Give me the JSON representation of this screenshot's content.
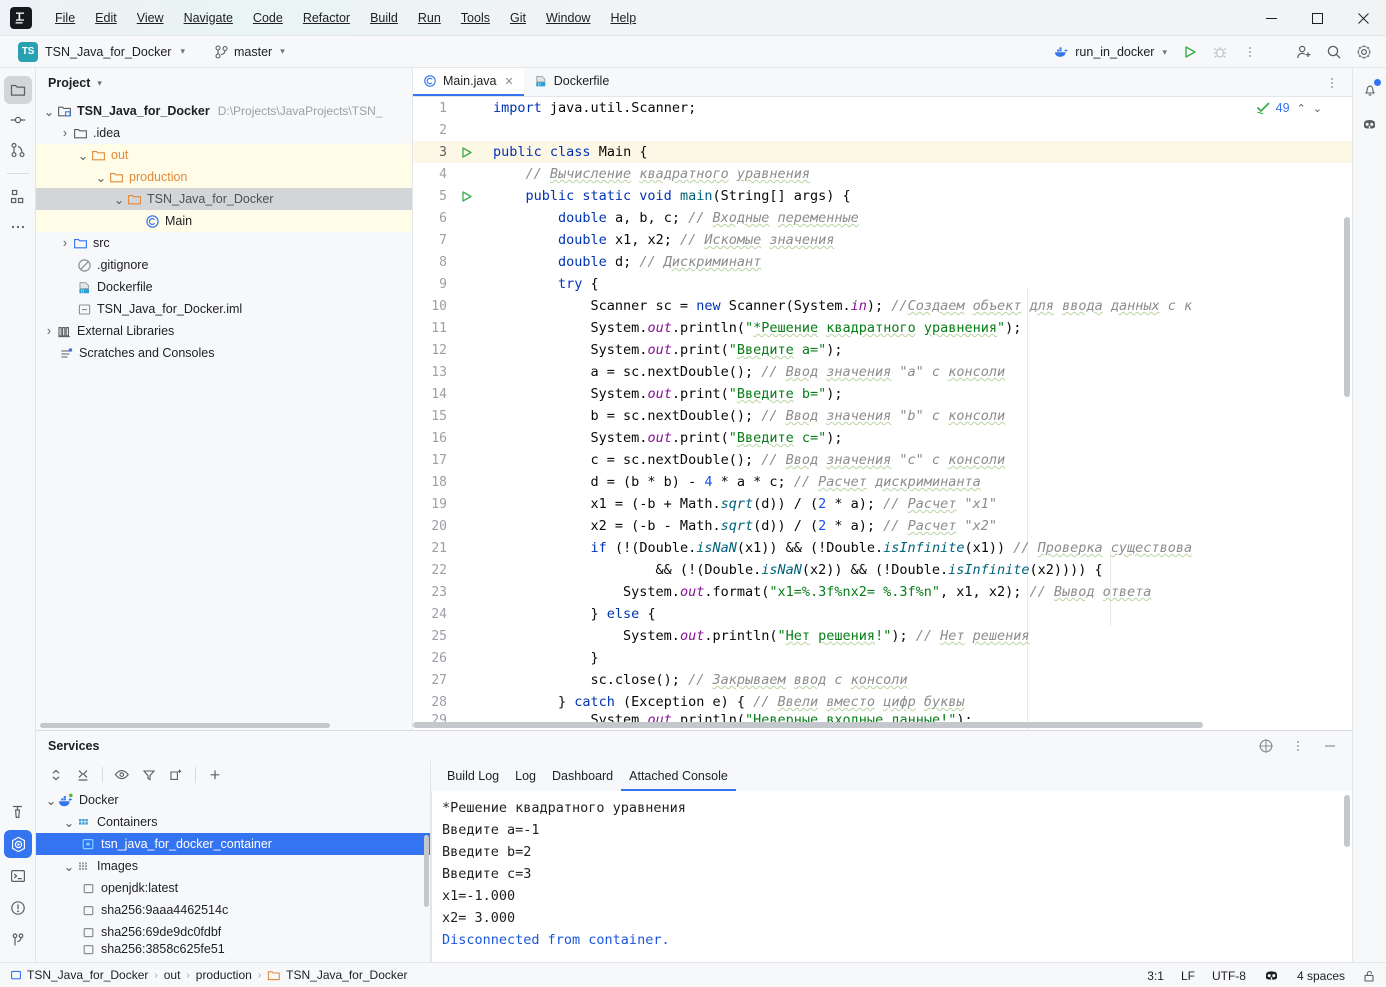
{
  "window": {
    "minimize_label": "Minimize",
    "maximize_label": "Maximize",
    "close_label": "Close"
  },
  "menubar": {
    "items": [
      {
        "label": "File",
        "mnemonic": "F"
      },
      {
        "label": "Edit",
        "mnemonic": "E"
      },
      {
        "label": "View",
        "mnemonic": "V"
      },
      {
        "label": "Navigate",
        "mnemonic": "N"
      },
      {
        "label": "Code",
        "mnemonic": "C"
      },
      {
        "label": "Refactor",
        "mnemonic": "R"
      },
      {
        "label": "Build",
        "mnemonic": "B"
      },
      {
        "label": "Run",
        "mnemonic": "u"
      },
      {
        "label": "Tools",
        "mnemonic": "T"
      },
      {
        "label": "Git",
        "mnemonic": "G"
      },
      {
        "label": "Window",
        "mnemonic": "W"
      },
      {
        "label": "Help",
        "mnemonic": "H"
      }
    ]
  },
  "navbar": {
    "project_badge": "TS",
    "project_name": "TSN_Java_for_Docker",
    "branch_name": "master",
    "run_config_name": "run_in_docker",
    "run_button": "Run",
    "debug_button": "Debug",
    "more_button": "More",
    "account_button": "Account",
    "search_button": "Search Everywhere",
    "settings_button": "Settings"
  },
  "left_rail": {
    "top": [
      "project-icon",
      "commit-icon",
      "pull-requests-icon",
      "structure-icon",
      "more-tool-windows-icon"
    ],
    "bottom": [
      "build-icon",
      "services-icon",
      "terminal-icon",
      "problems-icon",
      "version-control-icon"
    ]
  },
  "right_rail": {
    "items": [
      "notifications-icon",
      "ai-assistant-icon"
    ]
  },
  "project_panel": {
    "title": "Project",
    "tree": [
      {
        "indent": 0,
        "arrow": "down",
        "icon": "project-root-icon",
        "label": "TSN_Java_for_Docker",
        "path": "D:\\Projects\\JavaProjects\\TSN_",
        "bold": true,
        "highlight": ""
      },
      {
        "indent": 1,
        "arrow": "right",
        "icon": "folder-icon",
        "label": ".idea",
        "path": "",
        "bold": false,
        "highlight": ""
      },
      {
        "indent": 1,
        "arrow": "down",
        "icon": "folder-orange-icon",
        "label": "out",
        "path": "",
        "bold": false,
        "highlight": "yellow"
      },
      {
        "indent": 2,
        "arrow": "down",
        "icon": "folder-orange-icon",
        "label": "production",
        "path": "",
        "bold": false,
        "highlight": "yellow"
      },
      {
        "indent": 3,
        "arrow": "down",
        "icon": "folder-orange-icon",
        "label": "TSN_Java_for_Docker",
        "path": "",
        "bold": false,
        "highlight": "selected"
      },
      {
        "indent": 4,
        "arrow": "none",
        "icon": "class-icon",
        "label": "Main",
        "path": "",
        "bold": false,
        "highlight": "yellow"
      },
      {
        "indent": 1,
        "arrow": "right",
        "icon": "folder-icon",
        "label": "src",
        "path": "",
        "bold": false,
        "highlight": ""
      },
      {
        "indent": 2,
        "arrow": "none",
        "icon": "gitignore-icon",
        "label": ".gitignore",
        "path": "",
        "bold": false,
        "highlight": ""
      },
      {
        "indent": 2,
        "arrow": "none",
        "icon": "dockerfile-icon",
        "label": "Dockerfile",
        "path": "",
        "bold": false,
        "highlight": ""
      },
      {
        "indent": 2,
        "arrow": "none",
        "icon": "iml-icon",
        "label": "TSN_Java_for_Docker.iml",
        "path": "",
        "bold": false,
        "highlight": ""
      },
      {
        "indent": 0,
        "arrow": "right",
        "icon": "library-icon",
        "label": "External Libraries",
        "path": "",
        "bold": false,
        "highlight": ""
      },
      {
        "indent": 0,
        "arrow": "none",
        "icon": "scratches-icon",
        "label": "Scratches and Consoles",
        "path": "",
        "bold": false,
        "highlight": ""
      }
    ]
  },
  "editor": {
    "tabs": [
      {
        "label": "Main.java",
        "icon": "class-icon",
        "active": true,
        "closable": true
      },
      {
        "label": "Dockerfile",
        "icon": "dockerfile-icon",
        "active": false,
        "closable": false
      }
    ],
    "options_button": "Options",
    "inspection": {
      "count": "49",
      "status_icon": "inspections-ok-icon",
      "up_label": "Previous highlighted error",
      "down_label": "Next highlighted error"
    },
    "lines": [
      {
        "n": "1",
        "run": false,
        "hl": false
      },
      {
        "n": "2",
        "run": false,
        "hl": false
      },
      {
        "n": "3",
        "run": true,
        "hl": true
      },
      {
        "n": "4",
        "run": false,
        "hl": false
      },
      {
        "n": "5",
        "run": true,
        "hl": false
      },
      {
        "n": "6",
        "run": false,
        "hl": false
      },
      {
        "n": "7",
        "run": false,
        "hl": false
      },
      {
        "n": "8",
        "run": false,
        "hl": false
      },
      {
        "n": "9",
        "run": false,
        "hl": false
      },
      {
        "n": "10",
        "run": false,
        "hl": false
      },
      {
        "n": "11",
        "run": false,
        "hl": false
      },
      {
        "n": "12",
        "run": false,
        "hl": false
      },
      {
        "n": "13",
        "run": false,
        "hl": false
      },
      {
        "n": "14",
        "run": false,
        "hl": false
      },
      {
        "n": "15",
        "run": false,
        "hl": false
      },
      {
        "n": "16",
        "run": false,
        "hl": false
      },
      {
        "n": "17",
        "run": false,
        "hl": false
      },
      {
        "n": "18",
        "run": false,
        "hl": false
      },
      {
        "n": "19",
        "run": false,
        "hl": false
      },
      {
        "n": "20",
        "run": false,
        "hl": false
      },
      {
        "n": "21",
        "run": false,
        "hl": false
      },
      {
        "n": "22",
        "run": false,
        "hl": false
      },
      {
        "n": "23",
        "run": false,
        "hl": false
      },
      {
        "n": "24",
        "run": false,
        "hl": false
      },
      {
        "n": "25",
        "run": false,
        "hl": false
      },
      {
        "n": "26",
        "run": false,
        "hl": false
      },
      {
        "n": "27",
        "run": false,
        "hl": false
      },
      {
        "n": "28",
        "run": false,
        "hl": false
      },
      {
        "n": "29",
        "run": false,
        "hl": false
      }
    ],
    "source": [
      "import java.util.Scanner;",
      "",
      "public class Main {",
      "    // Вычисление квадратного уравнения",
      "    public static void main(String[] args) {",
      "        double a, b, c; // Входные переменные",
      "        double x1, x2; // Искомые значения",
      "        double d; // Дискриминант",
      "        try {",
      "            Scanner sc = new Scanner(System.in); //Создаем объект для ввода данных с к",
      "            System.out.println(\"*Решение квадратного уравнения\");",
      "            System.out.print(\"Введите a=\");",
      "            a = sc.nextDouble(); // Ввод значения \"a\" с консоли",
      "            System.out.print(\"Введите b=\");",
      "            b = sc.nextDouble(); // Ввод значения \"b\" с консоли",
      "            System.out.print(\"Введите c=\");",
      "            c = sc.nextDouble(); // Ввод значения \"c\" с консоли",
      "            d = (b * b) - 4 * a * c; // Расчет дискриминанта",
      "            x1 = (-b + Math.sqrt(d)) / (2 * a); // Расчет \"x1\"",
      "            x2 = (-b - Math.sqrt(d)) / (2 * a); // Расчет \"x2\"",
      "            if (!(Double.isNaN(x1)) && (!Double.isInfinite(x1)) // Проверка существова",
      "                    && (!(Double.isNaN(x2)) && (!Double.isInfinite(x2)))) {",
      "                System.out.format(\"x1=%.3f%nx2= %.3f%n\", x1, x2); // Вывод ответа",
      "            } else {",
      "                System.out.println(\"Нет решения!\"); // Нет решения",
      "            }",
      "            sc.close(); // Закрываем ввод с консоли",
      "        } catch (Exception e) { // Ввели вместо цифр буквы",
      "            System.out.println(\"Неверные входные данные!\");"
    ]
  },
  "services": {
    "title": "Services",
    "toolbar": [
      "expand-collapse-icon",
      "collapse-all-icon",
      "show-icon",
      "filter-icon",
      "new-tab-icon",
      "add-icon"
    ],
    "header_buttons": [
      "help-icon",
      "options-icon",
      "hide-icon"
    ],
    "tree": [
      {
        "indent": 0,
        "arrow": "down",
        "icon": "docker-icon",
        "label": "Docker",
        "selected": false
      },
      {
        "indent": 1,
        "arrow": "down",
        "icon": "containers-icon",
        "label": "Containers",
        "selected": false
      },
      {
        "indent": 2,
        "arrow": "none",
        "icon": "container-icon",
        "label": "tsn_java_for_docker_container",
        "selected": true
      },
      {
        "indent": 1,
        "arrow": "down",
        "icon": "images-icon",
        "label": "Images",
        "selected": false
      },
      {
        "indent": 2,
        "arrow": "none",
        "icon": "image-icon",
        "label": "openjdk:latest",
        "selected": false
      },
      {
        "indent": 2,
        "arrow": "none",
        "icon": "image-icon",
        "label": "sha256:9aaa4462514c",
        "selected": false
      },
      {
        "indent": 2,
        "arrow": "none",
        "icon": "image-icon",
        "label": "sha256:69de9dc0fdbf",
        "selected": false
      },
      {
        "indent": 2,
        "arrow": "none",
        "icon": "image-icon",
        "label": "sha256:3858c625fe51",
        "selected": false
      }
    ],
    "console_tabs": [
      {
        "label": "Build Log",
        "active": false
      },
      {
        "label": "Log",
        "active": false
      },
      {
        "label": "Dashboard",
        "active": false
      },
      {
        "label": "Attached Console",
        "active": true
      }
    ],
    "console_output": [
      {
        "text": "*Решение квадратного уравнения",
        "link": false
      },
      {
        "text": "Введите a=-1",
        "link": false
      },
      {
        "text": "Введите b=2",
        "link": false
      },
      {
        "text": "Введите c=3",
        "link": false
      },
      {
        "text": "x1=-1.000",
        "link": false
      },
      {
        "text": "x2= 3.000",
        "link": false
      },
      {
        "text": "Disconnected from container.",
        "link": true
      }
    ]
  },
  "statusbar": {
    "breadcrumbs": [
      {
        "label": "TSN_Java_for_Docker",
        "icon": "module-icon"
      },
      {
        "label": "out",
        "icon": ""
      },
      {
        "label": "production",
        "icon": ""
      },
      {
        "label": "TSN_Java_for_Docker",
        "icon": "folder-orange-icon"
      }
    ],
    "caret_position": "3:1",
    "line_separator": "LF",
    "encoding": "UTF-8",
    "ai_icon": "ai-assistant-icon",
    "indent": "4 spaces",
    "lock_icon": "unlocked-icon"
  },
  "colors": {
    "accent": "#3574f0",
    "selection": "#3574f0",
    "highlight_yellow": "#fffce8",
    "keyword": "#0033b3",
    "string": "#067d17",
    "comment": "#8c8c8c",
    "number": "#1750eb",
    "field": "#871094",
    "method": "#00627a"
  }
}
